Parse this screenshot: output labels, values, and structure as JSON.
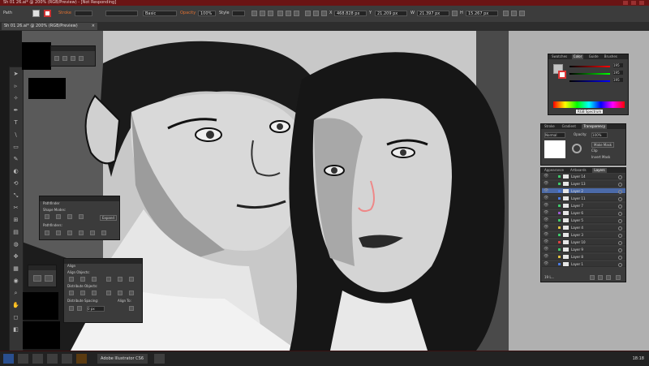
{
  "window": {
    "title": "Sh 01 26.ai* @ 200% (RGB/Preview) - [Not Responding]"
  },
  "control_bar": {
    "path_label": "Path",
    "stroke_label": "Stroke",
    "brush_label": "Basic",
    "opacity_label": "Opacity",
    "opacity_value": "100%",
    "style_label": "Style",
    "x_label": "X",
    "x_value": "468.828 px",
    "y_label": "Y",
    "y_value": "21.209 px",
    "w_label": "W",
    "w_value": "21.397 px",
    "h_label": "H",
    "h_value": "15.267 px"
  },
  "doc_tab": {
    "label": "Sh 01 26.ai* @ 200% (RGB/Preview)",
    "close": "×"
  },
  "tools": [
    "➤",
    "▹",
    "✧",
    "✒",
    "T",
    "\\",
    "▭",
    "✎",
    "◐",
    "⟲",
    "⤡",
    "✂",
    "⊞",
    "▤",
    "◍",
    "✥",
    "▦",
    "◉",
    "⌕",
    "✋",
    "◻",
    "◧"
  ],
  "pathfinder": {
    "title": "Pathfinder",
    "shape_modes_label": "Shape Modes:",
    "expand_label": "Expand",
    "pathfinders_label": "Pathfinders:"
  },
  "align": {
    "title": "Align",
    "align_objects_label": "Align Objects:",
    "distribute_objects_label": "Distribute Objects:",
    "distribute_spacing_label": "Distribute Spacing:",
    "align_to_label": "Align To:",
    "spacing_value": "0 px"
  },
  "color_panel": {
    "tabs": [
      "Swatches",
      "Color",
      "Guide",
      "Brushes"
    ],
    "active_tab": "Color",
    "values": [
      "195",
      "195",
      "195"
    ],
    "tooltip": "RGB Spectrum"
  },
  "transparency_panel": {
    "tabs": [
      "Stroke",
      "Gradient",
      "Transparency"
    ],
    "active_tab": "Transparency",
    "mode": "Normal",
    "opacity_label": "Opacity:",
    "opacity_value": "100%",
    "make_mask": "Make Mask",
    "clip": "Clip",
    "invert_mask": "Invert Mask"
  },
  "layers_panel": {
    "tabs": [
      "Appearance",
      "Artboards",
      "Layers"
    ],
    "active_tab": "Layers",
    "footer": "19 L...",
    "layers": [
      {
        "name": "Layer 14",
        "chip": "#3ec86a",
        "selected": false
      },
      {
        "name": "Layer 13",
        "chip": "#3ec86a",
        "selected": false
      },
      {
        "name": "Layer 2",
        "chip": "#4a7ae0",
        "selected": true
      },
      {
        "name": "Layer 11",
        "chip": "#4a7ae0",
        "selected": false
      },
      {
        "name": "Layer 7",
        "chip": "#3ec86a",
        "selected": false
      },
      {
        "name": "Layer 6",
        "chip": "#9a5ad0",
        "selected": false
      },
      {
        "name": "Layer 5",
        "chip": "#3ec86a",
        "selected": false
      },
      {
        "name": "Layer 4",
        "chip": "#e0c040",
        "selected": false
      },
      {
        "name": "Layer 3",
        "chip": "#3ec86a",
        "selected": false
      },
      {
        "name": "Layer 10",
        "chip": "#d84040",
        "selected": false
      },
      {
        "name": "Layer 9",
        "chip": "#3ec86a",
        "selected": false
      },
      {
        "name": "Layer 8",
        "chip": "#e0c040",
        "selected": false
      },
      {
        "name": "Layer 1",
        "chip": "#4a7ae0",
        "selected": false
      }
    ]
  },
  "taskbar": {
    "app_label": "Adobe Illustrator CS6",
    "clock": "18:18"
  }
}
